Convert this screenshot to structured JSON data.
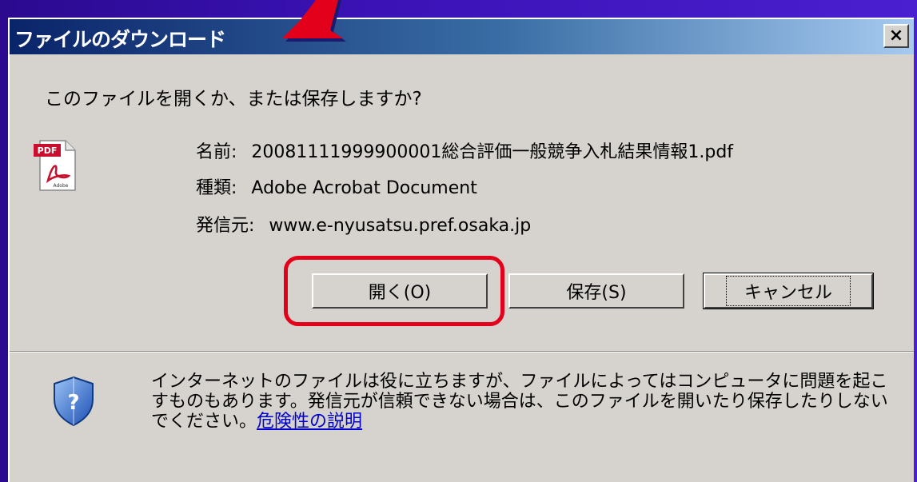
{
  "dialog": {
    "title": "ファイルのダウンロード",
    "close_label": "×",
    "question": "このファイルを開くか、または保存しますか?",
    "file": {
      "name_label": "名前:",
      "name_value": "20081111999900001総合評価一般競争入札結果情報1.pdf",
      "type_label": "種類:",
      "type_value": "Adobe Acrobat Document",
      "source_label": "発信元:",
      "source_value": "www.e-nyusatsu.pref.osaka.jp",
      "icon_label": "PDF",
      "icon_sublabel": "Adobe"
    },
    "buttons": {
      "open": "開く(O)",
      "save": "保存(S)",
      "cancel": "キャンセル"
    },
    "warning_text": "インターネットのファイルは役に立ちますが、ファイルによってはコンピュータに問題を起こすものもあります。発信元が信頼できない場合は、このファイルを開いたり保存したりしないでください。",
    "warning_link": "危険性の説明"
  },
  "annotations": {
    "highlight_color": "#e3001b",
    "arrow_color": "#e3001b"
  }
}
